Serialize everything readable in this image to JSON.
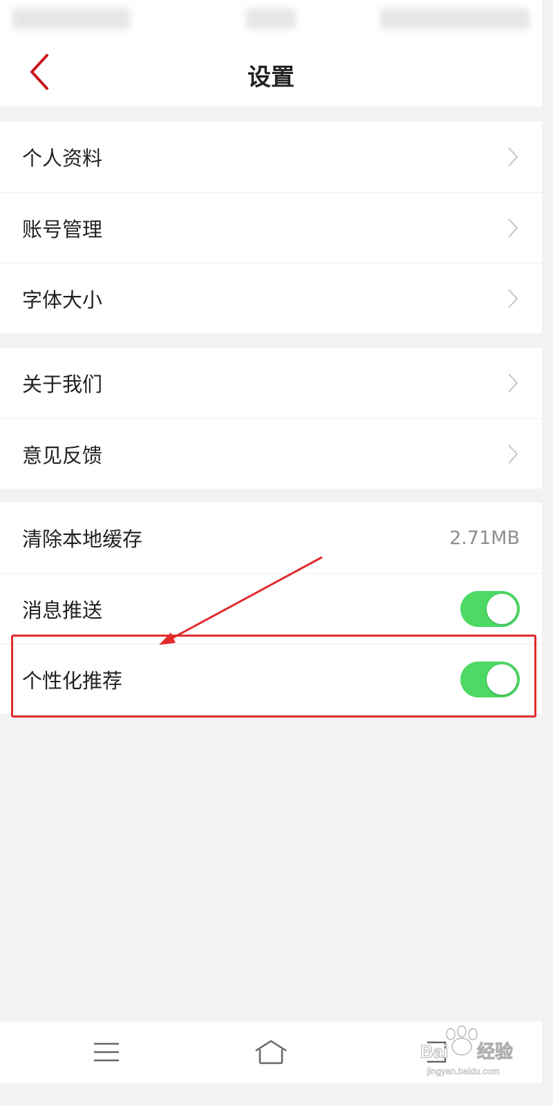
{
  "header": {
    "title": "设置"
  },
  "groups": [
    {
      "items": [
        {
          "label": "个人资料"
        },
        {
          "label": "账号管理"
        },
        {
          "label": "字体大小"
        }
      ]
    },
    {
      "items": [
        {
          "label": "关于我们"
        },
        {
          "label": "意见反馈"
        }
      ]
    },
    {
      "items": [
        {
          "label": "清除本地缓存",
          "value": "2.71MB"
        },
        {
          "label": "消息推送",
          "toggle_on": true
        },
        {
          "label": "个性化推荐",
          "toggle_on": true
        }
      ]
    }
  ],
  "colors": {
    "accent_red": "#c8161d",
    "toggle_green": "#4cd964",
    "annotation_red": "#e02b2b"
  },
  "icons": {
    "back": "chevron-left-icon",
    "row_arrow": "chevron-right-icon",
    "nav_menu": "menu-icon",
    "nav_home": "home-icon",
    "nav_back": "back-icon"
  },
  "watermark": {
    "text": "Baidu经验",
    "url_text": "jingyan.baidu.com"
  }
}
